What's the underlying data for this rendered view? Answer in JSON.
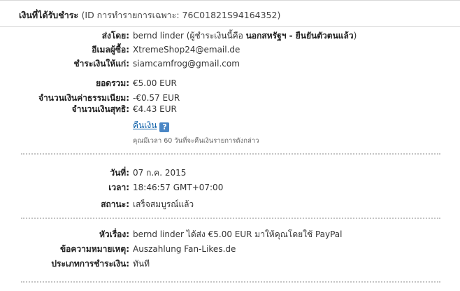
{
  "header": {
    "title": "เงินที่ได้รับชำระ",
    "id_text": "(ID การทำรายการเฉพาะ: 76C01821S94164352)"
  },
  "sender": {
    "label": "ส่งโดย:",
    "name": "bernd linder",
    "detail_prefix": "(ผู้ชำระเงินนี้คือ",
    "detail_bold": "นอกสหรัฐฯ - ยืนยันตัวตนแล้ว",
    "detail_suffix": ")"
  },
  "buyer_email": {
    "label": "อีเมลผู้ซื้อ:",
    "value": "XtremeShop24@email.de"
  },
  "paid_to": {
    "label": "ชำระเงินให้แก่:",
    "value": "siamcamfrog@gmail.com"
  },
  "total": {
    "label": "ยอดรวม:",
    "value": "€5.00 EUR"
  },
  "fee": {
    "label": "จำนวนเงินค่าธรรมเนียม:",
    "value": "-€0.57 EUR"
  },
  "net": {
    "label": "จำนวนเงินสุทธิ:",
    "value": "€4.43 EUR"
  },
  "refund": {
    "link_label": "คืนเงิน",
    "help_icon": "question-mark-icon",
    "note": "คุณมีเวลา 60 วันที่จะคืนเงินรายการดังกล่าว"
  },
  "date": {
    "label": "วันที่:",
    "value": "07 ก.ค. 2015"
  },
  "time": {
    "label": "เวลา:",
    "value": "18:46:57 GMT+07:00"
  },
  "status": {
    "label": "สถานะ:",
    "value": "เสร็จสมบูรณ์แล้ว"
  },
  "subject": {
    "label": "หัวเรื่อง:",
    "value": "bernd linder ได้ส่ง €5.00 EUR มาให้คุณโดยใช้ PayPal"
  },
  "note_msg": {
    "label": "ข้อความหมายเหตุ:",
    "value": "Auszahlung Fan-Likes.de"
  },
  "payment_type": {
    "label": "ประเภทการชำระเงิน:",
    "value": "ทันที"
  },
  "colors": {
    "link": "#0b5ea8",
    "help_icon_bg": "#4a86c5",
    "divider": "#c4c4c4"
  }
}
